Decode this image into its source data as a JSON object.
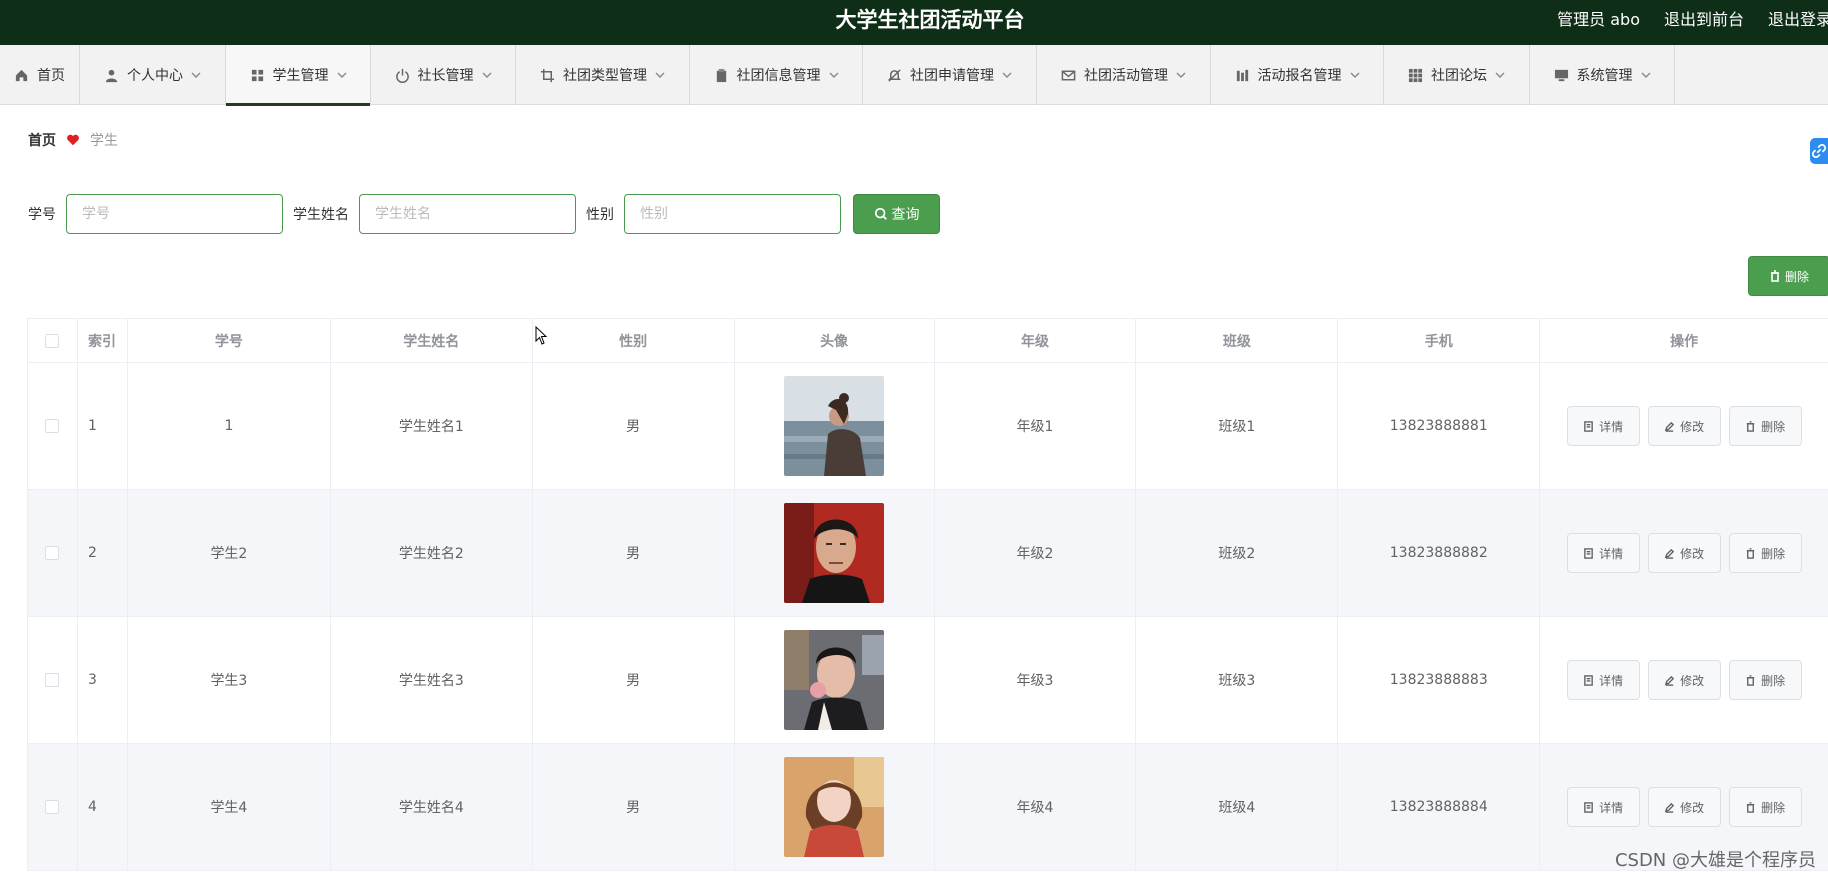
{
  "header": {
    "title": "大学生社团活动平台",
    "user": "管理员 abo",
    "back_to_front": "退出到前台",
    "logout": "退出登录"
  },
  "nav": [
    {
      "label": "首页",
      "icon": "home-icon"
    },
    {
      "label": "个人中心",
      "icon": "user-icon"
    },
    {
      "label": "学生管理",
      "icon": "grid-icon",
      "active": true
    },
    {
      "label": "社长管理",
      "icon": "power-icon"
    },
    {
      "label": "社团类型管理",
      "icon": "crop-icon"
    },
    {
      "label": "社团信息管理",
      "icon": "clipboard-icon"
    },
    {
      "label": "社团申请管理",
      "icon": "bell-off-icon"
    },
    {
      "label": "社团活动管理",
      "icon": "mail-icon"
    },
    {
      "label": "活动报名管理",
      "icon": "bar-chart-icon"
    },
    {
      "label": "社团论坛",
      "icon": "apps-icon"
    },
    {
      "label": "系统管理",
      "icon": "monitor-icon"
    }
  ],
  "breadcrumb": {
    "home": "首页",
    "current": "学生"
  },
  "search": {
    "id_label": "学号",
    "id_placeholder": "学号",
    "name_label": "学生姓名",
    "name_placeholder": "学生姓名",
    "sex_label": "性别",
    "sex_placeholder": "性别",
    "query_button": "查询"
  },
  "actions": {
    "delete_button": "删除"
  },
  "table": {
    "columns": [
      "索引",
      "学号",
      "学生姓名",
      "性别",
      "头像",
      "年级",
      "班级",
      "手机",
      "操作"
    ],
    "rows": [
      {
        "index": "1",
        "id": "1",
        "name": "学生姓名1",
        "sex": "男",
        "avatar": "woman-by-sea-photo",
        "grade": "年级1",
        "class": "班级1",
        "phone": "13823888881"
      },
      {
        "index": "2",
        "id": "学生2",
        "name": "学生姓名2",
        "sex": "男",
        "avatar": "man-portrait-photo",
        "grade": "年级2",
        "class": "班级2",
        "phone": "13823888882"
      },
      {
        "index": "3",
        "id": "学生3",
        "name": "学生姓名3",
        "sex": "男",
        "avatar": "man-selfie-photo",
        "grade": "年级3",
        "class": "班级3",
        "phone": "13823888883"
      },
      {
        "index": "4",
        "id": "学生4",
        "name": "学生姓名4",
        "sex": "男",
        "avatar": "girl-portrait-photo",
        "grade": "年级4",
        "class": "班级4",
        "phone": "13823888884"
      }
    ],
    "row_actions": {
      "detail": "详情",
      "edit": "修改",
      "delete": "删除"
    }
  },
  "watermark": "CSDN @大雄是个程序员",
  "colors": {
    "header_bg": "#0f2e17",
    "accent": "#4b9e4e",
    "nav_bg": "#f2f2f2",
    "heart": "#e02020"
  }
}
